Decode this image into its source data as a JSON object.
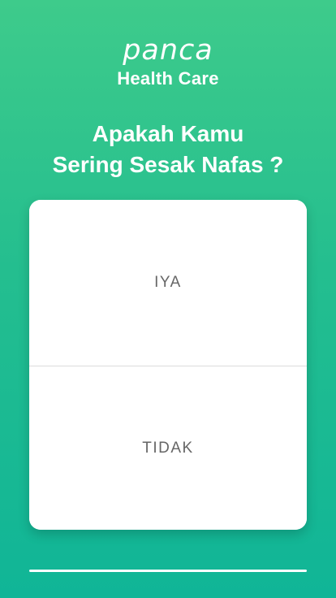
{
  "brand": {
    "logo_text": "panca",
    "tagline": "Health Care"
  },
  "question": {
    "line1": "Apakah Kamu",
    "line2": "Sering Sesak Nafas ?"
  },
  "answers": {
    "yes_label": "IYA",
    "no_label": "TIDAK"
  },
  "colors": {
    "background_top": "#3ecb8b",
    "background_bottom": "#10b597",
    "card": "#ffffff",
    "option_text": "#666666"
  }
}
